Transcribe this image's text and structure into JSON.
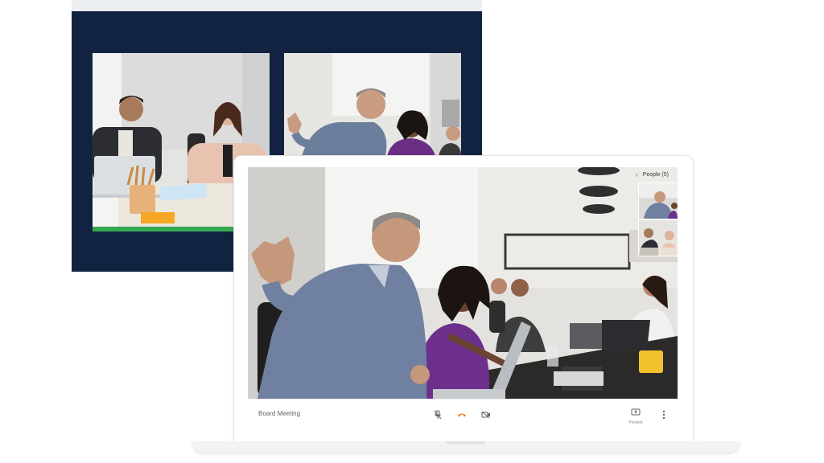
{
  "meeting": {
    "title": "Board Meeting"
  },
  "people_panel": {
    "label": "People (5)"
  },
  "controls": {
    "mic_icon": "mic-off-icon",
    "hangup_icon": "hangup-icon",
    "camera_icon": "camera-icon",
    "present_label": "Present",
    "more_icon": "more-vert-icon"
  },
  "colors": {
    "hangup": "#e8710a",
    "tv_frame": "#112340",
    "screen_share_accent": "#3aa757"
  }
}
